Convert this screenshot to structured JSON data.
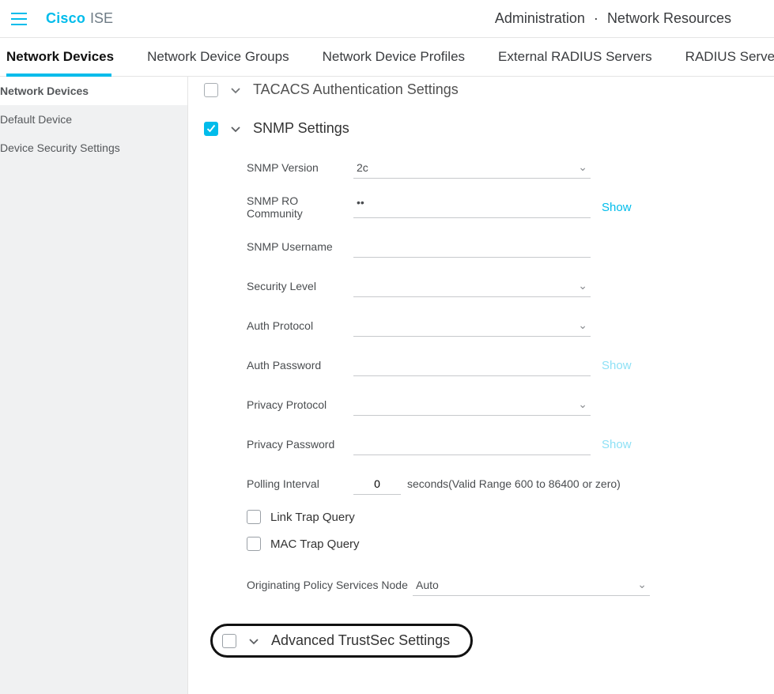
{
  "brand": {
    "cisco": "Cisco",
    "ise": "ISE"
  },
  "breadcrumb": {
    "a": "Administration",
    "b": "Network Resources"
  },
  "tabs": {
    "t0": "Network Devices",
    "t1": "Network Device Groups",
    "t2": "Network Device Profiles",
    "t3": "External RADIUS Servers",
    "t4": "RADIUS Serve"
  },
  "sidebar": {
    "s0": "Network Devices",
    "s1": "Default Device",
    "s2": "Device Security Settings"
  },
  "sections": {
    "tacacs": "TACACS Authentication Settings",
    "snmp": "SNMP Settings",
    "trustsec": "Advanced TrustSec Settings"
  },
  "snmp": {
    "version_label": "SNMP Version",
    "version_value": "2c",
    "ro_label": "SNMP RO Community",
    "ro_value": "••",
    "user_label": "SNMP Username",
    "seclevel_label": "Security Level",
    "authproto_label": "Auth Protocol",
    "authpass_label": "Auth Password",
    "privproto_label": "Privacy Protocol",
    "privpass_label": "Privacy Password",
    "poll_label": "Polling Interval",
    "poll_value": "0",
    "poll_hint": "seconds(Valid Range 600 to 86400 or zero)",
    "linktrap": "Link Trap Query",
    "mactrap": "MAC Trap Query",
    "psn_label": "Originating Policy Services Node",
    "psn_value": "Auto"
  },
  "buttons": {
    "show": "Show"
  }
}
